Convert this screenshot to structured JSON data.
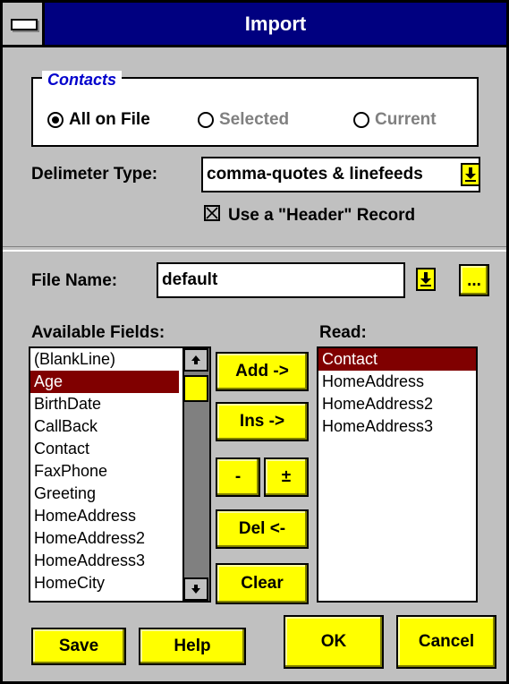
{
  "window": {
    "title": "Import"
  },
  "contacts": {
    "group_label": "Contacts",
    "options": [
      {
        "label": "All on File",
        "selected": true,
        "enabled": true
      },
      {
        "label": "Selected",
        "selected": false,
        "enabled": false
      },
      {
        "label": "Current",
        "selected": false,
        "enabled": false
      }
    ]
  },
  "delimiter": {
    "label": "Delimeter Type:",
    "value": "comma-quotes & linefeeds"
  },
  "header_record": {
    "label": "Use a \"Header\" Record",
    "checked": true
  },
  "file": {
    "label": "File Name:",
    "value": "default",
    "browse_label": "..."
  },
  "available": {
    "label": "Available Fields:",
    "items": [
      "(BlankLine)",
      "Age",
      "BirthDate",
      "CallBack",
      "Contact",
      "FaxPhone",
      "Greeting",
      "HomeAddress",
      "HomeAddress2",
      "HomeAddress3",
      "HomeCity"
    ],
    "selected_index": 1
  },
  "read": {
    "label": "Read:",
    "items": [
      "Contact",
      "HomeAddress",
      "HomeAddress2",
      "HomeAddress3"
    ],
    "selected_index": 0
  },
  "buttons": {
    "add": "Add ->",
    "ins": "Ins ->",
    "minus": "-",
    "plusminus": "±",
    "del": "Del <-",
    "clear": "Clear",
    "save": "Save",
    "help": "Help",
    "ok": "OK",
    "cancel": "Cancel"
  },
  "colors": {
    "button_face": "#ffff00",
    "title_bar": "#000080",
    "selection": "#800000",
    "group_label": "#0000cc"
  },
  "icons": {
    "dropdown": "down-arrow-bar-icon",
    "scroll_up": "up-arrow-icon",
    "scroll_down": "down-arrow-icon",
    "system_menu": "system-menu-icon"
  }
}
